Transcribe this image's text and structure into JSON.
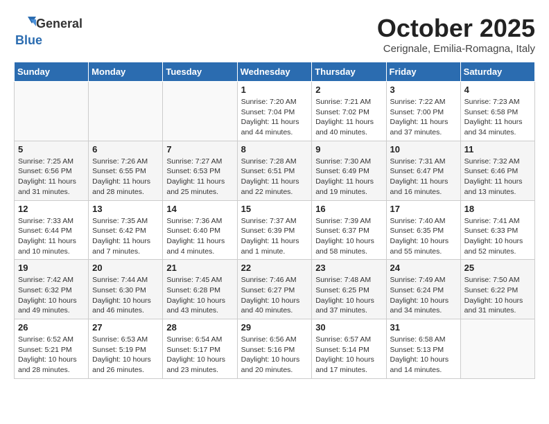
{
  "header": {
    "logo_general": "General",
    "logo_blue": "Blue",
    "month_title": "October 2025",
    "location": "Cerignale, Emilia-Romagna, Italy"
  },
  "weekdays": [
    "Sunday",
    "Monday",
    "Tuesday",
    "Wednesday",
    "Thursday",
    "Friday",
    "Saturday"
  ],
  "weeks": [
    [
      {
        "day": "",
        "sunrise": "",
        "sunset": "",
        "daylight": ""
      },
      {
        "day": "",
        "sunrise": "",
        "sunset": "",
        "daylight": ""
      },
      {
        "day": "",
        "sunrise": "",
        "sunset": "",
        "daylight": ""
      },
      {
        "day": "1",
        "sunrise": "Sunrise: 7:20 AM",
        "sunset": "Sunset: 7:04 PM",
        "daylight": "Daylight: 11 hours and 44 minutes."
      },
      {
        "day": "2",
        "sunrise": "Sunrise: 7:21 AM",
        "sunset": "Sunset: 7:02 PM",
        "daylight": "Daylight: 11 hours and 40 minutes."
      },
      {
        "day": "3",
        "sunrise": "Sunrise: 7:22 AM",
        "sunset": "Sunset: 7:00 PM",
        "daylight": "Daylight: 11 hours and 37 minutes."
      },
      {
        "day": "4",
        "sunrise": "Sunrise: 7:23 AM",
        "sunset": "Sunset: 6:58 PM",
        "daylight": "Daylight: 11 hours and 34 minutes."
      }
    ],
    [
      {
        "day": "5",
        "sunrise": "Sunrise: 7:25 AM",
        "sunset": "Sunset: 6:56 PM",
        "daylight": "Daylight: 11 hours and 31 minutes."
      },
      {
        "day": "6",
        "sunrise": "Sunrise: 7:26 AM",
        "sunset": "Sunset: 6:55 PM",
        "daylight": "Daylight: 11 hours and 28 minutes."
      },
      {
        "day": "7",
        "sunrise": "Sunrise: 7:27 AM",
        "sunset": "Sunset: 6:53 PM",
        "daylight": "Daylight: 11 hours and 25 minutes."
      },
      {
        "day": "8",
        "sunrise": "Sunrise: 7:28 AM",
        "sunset": "Sunset: 6:51 PM",
        "daylight": "Daylight: 11 hours and 22 minutes."
      },
      {
        "day": "9",
        "sunrise": "Sunrise: 7:30 AM",
        "sunset": "Sunset: 6:49 PM",
        "daylight": "Daylight: 11 hours and 19 minutes."
      },
      {
        "day": "10",
        "sunrise": "Sunrise: 7:31 AM",
        "sunset": "Sunset: 6:47 PM",
        "daylight": "Daylight: 11 hours and 16 minutes."
      },
      {
        "day": "11",
        "sunrise": "Sunrise: 7:32 AM",
        "sunset": "Sunset: 6:46 PM",
        "daylight": "Daylight: 11 hours and 13 minutes."
      }
    ],
    [
      {
        "day": "12",
        "sunrise": "Sunrise: 7:33 AM",
        "sunset": "Sunset: 6:44 PM",
        "daylight": "Daylight: 11 hours and 10 minutes."
      },
      {
        "day": "13",
        "sunrise": "Sunrise: 7:35 AM",
        "sunset": "Sunset: 6:42 PM",
        "daylight": "Daylight: 11 hours and 7 minutes."
      },
      {
        "day": "14",
        "sunrise": "Sunrise: 7:36 AM",
        "sunset": "Sunset: 6:40 PM",
        "daylight": "Daylight: 11 hours and 4 minutes."
      },
      {
        "day": "15",
        "sunrise": "Sunrise: 7:37 AM",
        "sunset": "Sunset: 6:39 PM",
        "daylight": "Daylight: 11 hours and 1 minute."
      },
      {
        "day": "16",
        "sunrise": "Sunrise: 7:39 AM",
        "sunset": "Sunset: 6:37 PM",
        "daylight": "Daylight: 10 hours and 58 minutes."
      },
      {
        "day": "17",
        "sunrise": "Sunrise: 7:40 AM",
        "sunset": "Sunset: 6:35 PM",
        "daylight": "Daylight: 10 hours and 55 minutes."
      },
      {
        "day": "18",
        "sunrise": "Sunrise: 7:41 AM",
        "sunset": "Sunset: 6:33 PM",
        "daylight": "Daylight: 10 hours and 52 minutes."
      }
    ],
    [
      {
        "day": "19",
        "sunrise": "Sunrise: 7:42 AM",
        "sunset": "Sunset: 6:32 PM",
        "daylight": "Daylight: 10 hours and 49 minutes."
      },
      {
        "day": "20",
        "sunrise": "Sunrise: 7:44 AM",
        "sunset": "Sunset: 6:30 PM",
        "daylight": "Daylight: 10 hours and 46 minutes."
      },
      {
        "day": "21",
        "sunrise": "Sunrise: 7:45 AM",
        "sunset": "Sunset: 6:28 PM",
        "daylight": "Daylight: 10 hours and 43 minutes."
      },
      {
        "day": "22",
        "sunrise": "Sunrise: 7:46 AM",
        "sunset": "Sunset: 6:27 PM",
        "daylight": "Daylight: 10 hours and 40 minutes."
      },
      {
        "day": "23",
        "sunrise": "Sunrise: 7:48 AM",
        "sunset": "Sunset: 6:25 PM",
        "daylight": "Daylight: 10 hours and 37 minutes."
      },
      {
        "day": "24",
        "sunrise": "Sunrise: 7:49 AM",
        "sunset": "Sunset: 6:24 PM",
        "daylight": "Daylight: 10 hours and 34 minutes."
      },
      {
        "day": "25",
        "sunrise": "Sunrise: 7:50 AM",
        "sunset": "Sunset: 6:22 PM",
        "daylight": "Daylight: 10 hours and 31 minutes."
      }
    ],
    [
      {
        "day": "26",
        "sunrise": "Sunrise: 6:52 AM",
        "sunset": "Sunset: 5:21 PM",
        "daylight": "Daylight: 10 hours and 28 minutes."
      },
      {
        "day": "27",
        "sunrise": "Sunrise: 6:53 AM",
        "sunset": "Sunset: 5:19 PM",
        "daylight": "Daylight: 10 hours and 26 minutes."
      },
      {
        "day": "28",
        "sunrise": "Sunrise: 6:54 AM",
        "sunset": "Sunset: 5:17 PM",
        "daylight": "Daylight: 10 hours and 23 minutes."
      },
      {
        "day": "29",
        "sunrise": "Sunrise: 6:56 AM",
        "sunset": "Sunset: 5:16 PM",
        "daylight": "Daylight: 10 hours and 20 minutes."
      },
      {
        "day": "30",
        "sunrise": "Sunrise: 6:57 AM",
        "sunset": "Sunset: 5:14 PM",
        "daylight": "Daylight: 10 hours and 17 minutes."
      },
      {
        "day": "31",
        "sunrise": "Sunrise: 6:58 AM",
        "sunset": "Sunset: 5:13 PM",
        "daylight": "Daylight: 10 hours and 14 minutes."
      },
      {
        "day": "",
        "sunrise": "",
        "sunset": "",
        "daylight": ""
      }
    ]
  ]
}
